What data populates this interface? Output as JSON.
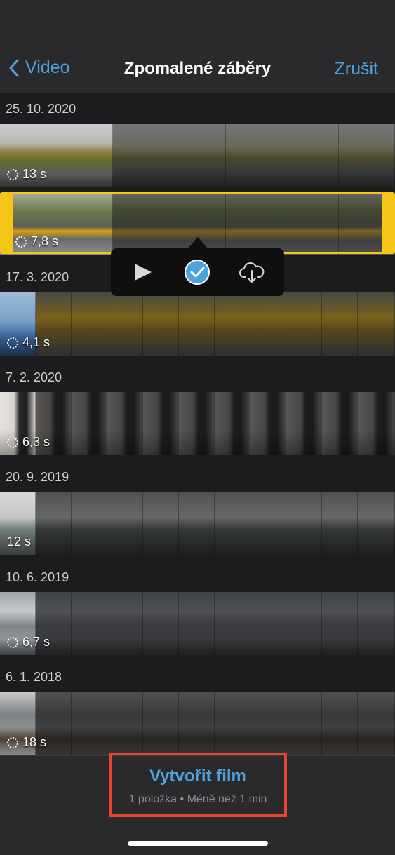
{
  "nav": {
    "back_label": "Video",
    "title": "Zpomalené záběry",
    "cancel_label": "Zrušit"
  },
  "groups": [
    {
      "date": "25. 10. 2020",
      "clips": [
        {
          "duration": "13 s"
        },
        {
          "duration": "7,8 s",
          "selected": true
        }
      ]
    },
    {
      "date": "17. 3. 2020",
      "clips": [
        {
          "duration": "4,1 s"
        }
      ]
    },
    {
      "date": "7. 2. 2020",
      "clips": [
        {
          "duration": "6,3 s"
        }
      ]
    },
    {
      "date": "20. 9. 2019",
      "clips": [
        {
          "duration": "12 s"
        }
      ]
    },
    {
      "date": "10. 6. 2019",
      "clips": [
        {
          "duration": "6,7 s"
        }
      ]
    },
    {
      "date": "6. 1. 2018",
      "clips": [
        {
          "duration": "18 s"
        }
      ]
    }
  ],
  "popup": {
    "buttons": [
      "play-icon",
      "checkmark-icon",
      "cloud-download-icon"
    ],
    "check_color": "#4da3e0"
  },
  "bottom": {
    "create_label": "Vytvořit film",
    "summary": "1 položka • Méně než 1 min"
  },
  "colors": {
    "accent": "#4da3e0",
    "selection": "#f5c518",
    "highlight": "#e8452c"
  }
}
